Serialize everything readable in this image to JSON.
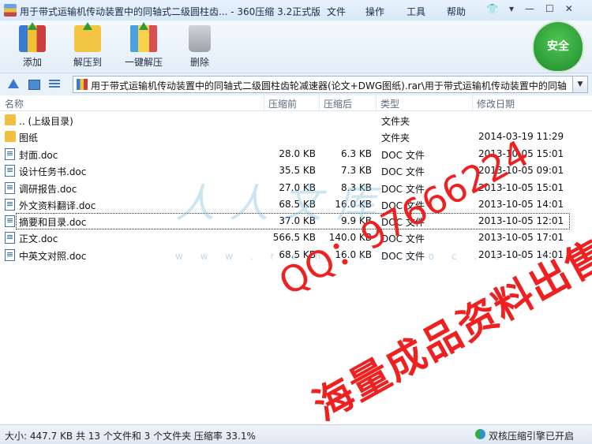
{
  "window": {
    "title": "用于带式运输机传动装置中的同轴式二级圆柱齿... - 360压缩 3.2正式版",
    "menus": [
      "文件",
      "操作",
      "工具",
      "帮助"
    ]
  },
  "toolbar": {
    "buttons": [
      {
        "label": "添加",
        "icon": "add-archive-icon"
      },
      {
        "label": "解压到",
        "icon": "extract-to-icon"
      },
      {
        "label": "一键解压",
        "icon": "one-click-extract-icon"
      },
      {
        "label": "删除",
        "icon": "delete-trash-icon"
      }
    ],
    "security_badge": "安全"
  },
  "address": {
    "path": "用于带式运输机传动装置中的同轴式二级圆柱齿轮减速器(论文+DWG图纸).rar\\用于带式运输机传动装置中的同轴"
  },
  "columns": {
    "name": "名称",
    "size": "压缩前",
    "packed": "压缩后",
    "type": "类型",
    "modified": "修改日期"
  },
  "files": [
    {
      "name": ".. (上级目录)",
      "size": "",
      "packed": "",
      "type": "文件夹",
      "modified": "",
      "kind": "folder"
    },
    {
      "name": "图纸",
      "size": "",
      "packed": "",
      "type": "文件夹",
      "modified": "2014-03-19 11:29",
      "kind": "folder"
    },
    {
      "name": "封面.doc",
      "size": "28.0 KB",
      "packed": "6.3 KB",
      "type": "DOC 文件",
      "modified": "2013-10-05 15:01",
      "kind": "doc"
    },
    {
      "name": "设计任务书.doc",
      "size": "35.5 KB",
      "packed": "7.3 KB",
      "type": "DOC 文件",
      "modified": "2013-10-05 09:01",
      "kind": "doc"
    },
    {
      "name": "调研报告.doc",
      "size": "27.0 KB",
      "packed": "8.3 KB",
      "type": "DOC 文件",
      "modified": "2013-10-05 15:01",
      "kind": "doc"
    },
    {
      "name": "外文资料翻译.doc",
      "size": "68.5 KB",
      "packed": "16.0 KB",
      "type": "DOC 文件",
      "modified": "2013-10-05 14:01",
      "kind": "doc"
    },
    {
      "name": "摘要和目录.doc",
      "size": "37.0 KB",
      "packed": "9.9 KB",
      "type": "DOC 文件",
      "modified": "2013-10-05 12:01",
      "kind": "doc"
    },
    {
      "name": "正文.doc",
      "size": "566.5 KB",
      "packed": "140.0 KB",
      "type": "DOC 文件",
      "modified": "2013-10-05 17:01",
      "kind": "doc"
    },
    {
      "name": "中英文对照.doc",
      "size": "68.5 KB",
      "packed": "16.0 KB",
      "type": "DOC 文件",
      "modified": "2013-10-05 14:01",
      "kind": "doc"
    }
  ],
  "watermark": {
    "logo": "人人文库",
    "url": "w w w . r e n r e n d o c . c o m",
    "qq": "QQ：97666224",
    "sell": "海量成品资料出售！"
  },
  "status": {
    "summary": "大小: 447.7 KB 共 13 个文件和 3 个文件夹 压缩率 33.1%",
    "engine": "双核压缩引擎已开启"
  }
}
